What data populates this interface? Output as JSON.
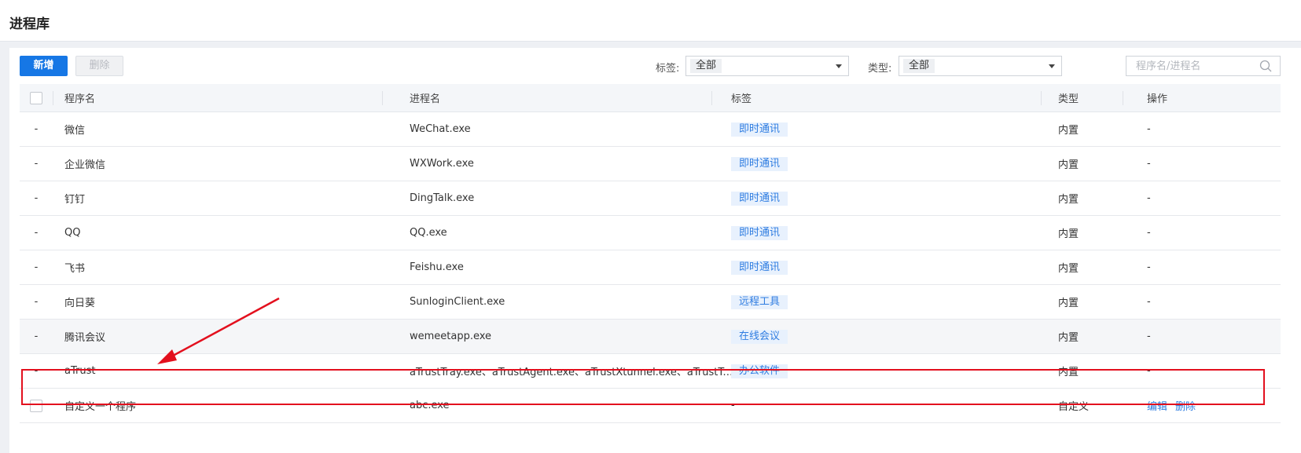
{
  "page": {
    "title": "进程库"
  },
  "toolbar": {
    "add_label": "新增",
    "delete_label": "删除",
    "tag_filter_label": "标签:",
    "tag_filter_value": "全部",
    "type_filter_label": "类型:",
    "type_filter_value": "全部",
    "search_placeholder": "程序名/进程名"
  },
  "table": {
    "headers": {
      "name": "程序名",
      "process": "进程名",
      "tag": "标签",
      "type": "类型",
      "ops": "操作"
    },
    "rows": [
      {
        "sel": "-",
        "name": "微信",
        "process": "WeChat.exe",
        "tag": "即时通讯",
        "type": "内置",
        "ops": "-"
      },
      {
        "sel": "-",
        "name": "企业微信",
        "process": "WXWork.exe",
        "tag": "即时通讯",
        "type": "内置",
        "ops": "-"
      },
      {
        "sel": "-",
        "name": "钉钉",
        "process": "DingTalk.exe",
        "tag": "即时通讯",
        "type": "内置",
        "ops": "-"
      },
      {
        "sel": "-",
        "name": "QQ",
        "process": "QQ.exe",
        "tag": "即时通讯",
        "type": "内置",
        "ops": "-"
      },
      {
        "sel": "-",
        "name": "飞书",
        "process": "Feishu.exe",
        "tag": "即时通讯",
        "type": "内置",
        "ops": "-"
      },
      {
        "sel": "-",
        "name": "向日葵",
        "process": "SunloginClient.exe",
        "tag": "远程工具",
        "type": "内置",
        "ops": "-"
      },
      {
        "sel": "-",
        "name": "腾讯会议",
        "process": "wemeetapp.exe",
        "tag": "在线会议",
        "type": "内置",
        "ops": "-"
      },
      {
        "sel": "-",
        "name": "aTrust",
        "process": "aTrustTray.exe、aTrustAgent.exe、aTrustXtunnel.exe、aTrustTunn...",
        "tag": "办公软件",
        "type": "内置",
        "ops": "-"
      }
    ],
    "custom_row": {
      "name": "自定义一个程序",
      "process": "abc.exe",
      "tag": "-",
      "type": "自定义",
      "edit_label": "编辑",
      "delete_label": "删除"
    }
  },
  "colors": {
    "primary": "#1677e5",
    "tag_bg": "#e8f1fd",
    "tag_text": "#2f7de1",
    "annotation": "#e3101e"
  }
}
